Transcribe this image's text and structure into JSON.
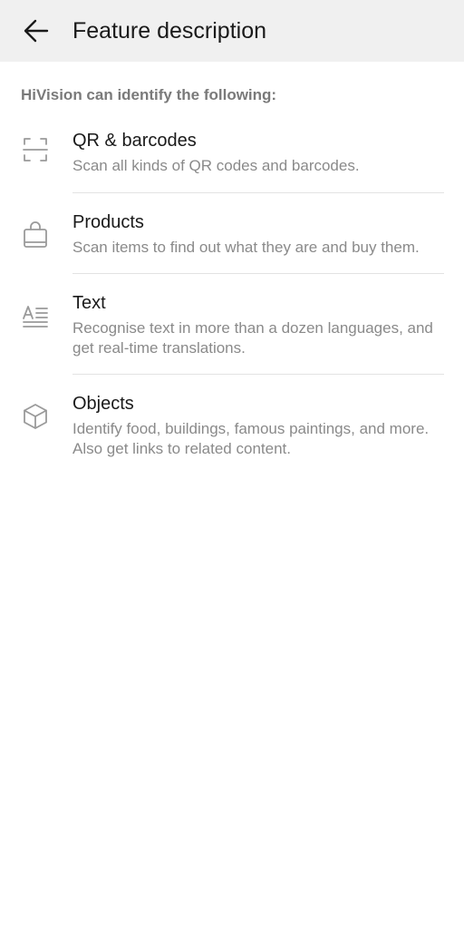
{
  "header": {
    "title": "Feature description",
    "back_icon": "arrow-left-icon"
  },
  "intro": {
    "label": "HiVision can identify the following:"
  },
  "features": [
    {
      "icon": "qr-scan-icon",
      "title": "QR & barcodes",
      "description": "Scan all kinds of QR codes and barcodes."
    },
    {
      "icon": "shopping-bag-icon",
      "title": "Products",
      "description": "Scan items to find out what they are and buy them."
    },
    {
      "icon": "text-recognition-icon",
      "title": "Text",
      "description": "Recognise text in more than a dozen languages, and get real-time translations."
    },
    {
      "icon": "cube-icon",
      "title": "Objects",
      "description": "Identify food, buildings, famous paintings, and more. Also get links to related content."
    }
  ],
  "colors": {
    "appbar_background": "#f0f0f0",
    "title_text": "#1a1a1a",
    "secondary_text": "#8a8a8a",
    "icon_gray": "#9a9a9a",
    "divider": "#e3e3e3"
  }
}
